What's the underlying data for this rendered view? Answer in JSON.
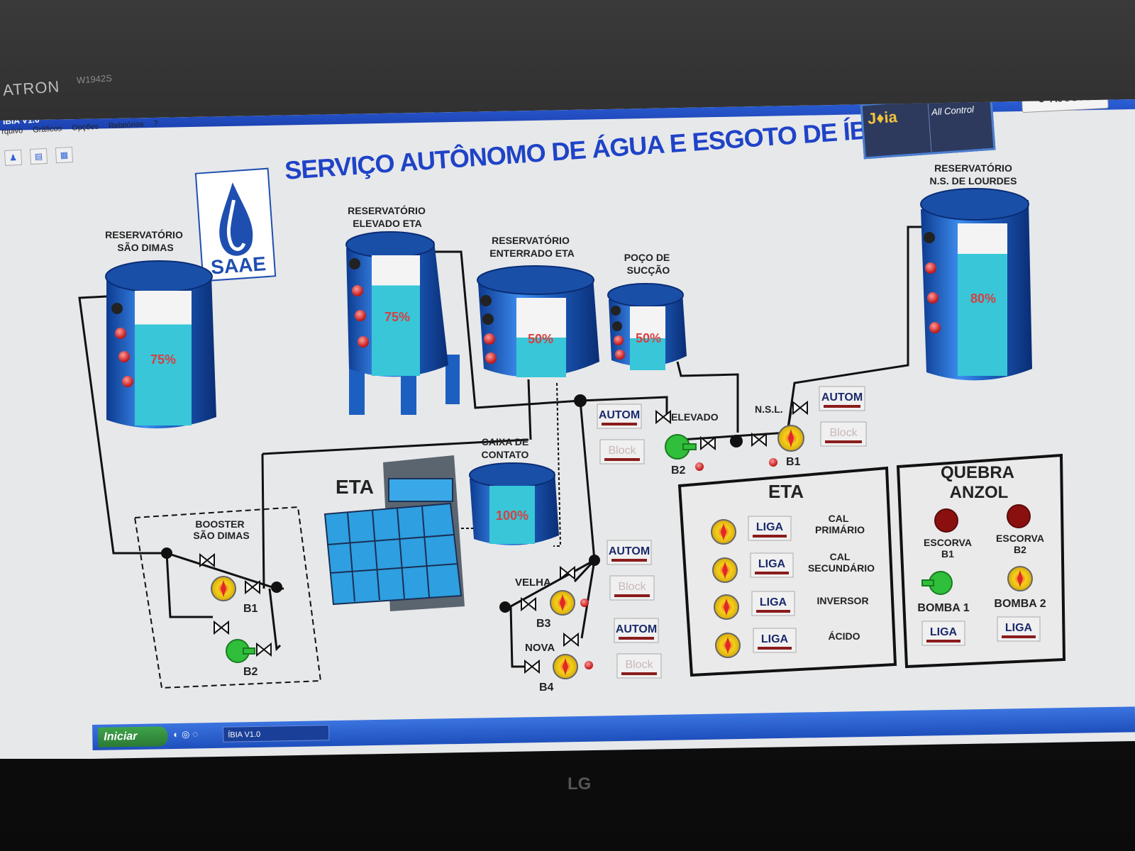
{
  "monitor": {
    "brand": "ATRON",
    "model": "W1942S",
    "logo": "LG"
  },
  "window": {
    "title": "ÍBIA V1.0"
  },
  "menu": [
    "rquivo",
    "Gráficos",
    "Opções",
    "Relatórios",
    "?"
  ],
  "header": {
    "title": "SERVIÇO AUTÔNOMO DE ÁGUA E ESGOTO DE ÍBIA",
    "saae_logo": "SAAE",
    "joia_logo": "J♦ia",
    "allcontrol_logo": "All Control",
    "ajuste_label": "AJUSTE"
  },
  "tanks": {
    "sao_dimas": {
      "label1": "RESERVATÓRIO",
      "label2": "SÃO DIMAS",
      "level": "75%"
    },
    "elevado_eta": {
      "label1": "RESERVATÓRIO",
      "label2": "ELEVADO ETA",
      "level": "75%"
    },
    "enterrado_eta": {
      "label1": "RESERVATÓRIO",
      "label2": "ENTERRADO ETA",
      "level": "50%"
    },
    "poco_succao": {
      "label1": "POÇO DE",
      "label2": "SUCÇÃO",
      "level": "50%"
    },
    "ns_lourdes": {
      "label1": "RESERVATÓRIO",
      "label2": "N.S. DE LOURDES",
      "level": "80%"
    },
    "caixa_contato": {
      "label1": "CAIXA DE",
      "label2": "CONTATO",
      "level": "100%"
    }
  },
  "levels": {
    "sao_dimas": 0.75,
    "elevado_eta": 0.75,
    "enterrado_eta": 0.5,
    "poco_succao": 0.5,
    "ns_lourdes": 0.8,
    "caixa_contato": 1.0
  },
  "eta_label": "ETA",
  "booster": {
    "label1": "BOOSTER",
    "label2": "SÃO DIMAS",
    "b1": "B1",
    "b2": "B2"
  },
  "pumps": {
    "elevado": "ELEVADO",
    "nsl": "N.S.L.",
    "b2": "B2",
    "b1": "B1",
    "velha": "VELHA",
    "b3": "B3",
    "nova": "NOVA",
    "b4": "B4"
  },
  "controls": {
    "autom": "AUTOM",
    "block": "Block",
    "liga": "LIGA"
  },
  "eta_panel": {
    "title": "ETA",
    "rows": [
      {
        "label1": "CAL",
        "label2": "PRIMÁRIO"
      },
      {
        "label1": "CAL",
        "label2": "SECUNDÁRIO"
      },
      {
        "label1": "INVERSOR",
        "label2": ""
      },
      {
        "label1": "ÁCIDO",
        "label2": ""
      }
    ]
  },
  "quebra_panel": {
    "title1": "QUEBRA",
    "title2": "ANZOL",
    "escorva_b1_1": "ESCORVA",
    "escorva_b1_2": "B1",
    "escorva_b2_1": "ESCORVA",
    "escorva_b2_2": "B2",
    "bomba1": "BOMBA 1",
    "bomba2": "BOMBA 2"
  },
  "taskbar": {
    "start": "Iniciar",
    "task": "ÍBIA V1.0"
  },
  "colors": {
    "title_blue": "#1f43c7",
    "water": "#38c6d8",
    "tank_blue": "#1d5fc0",
    "alarm_red": "#e02828",
    "pump_green": "#2fbf3a",
    "pump_yellow": "#f2d21a"
  }
}
